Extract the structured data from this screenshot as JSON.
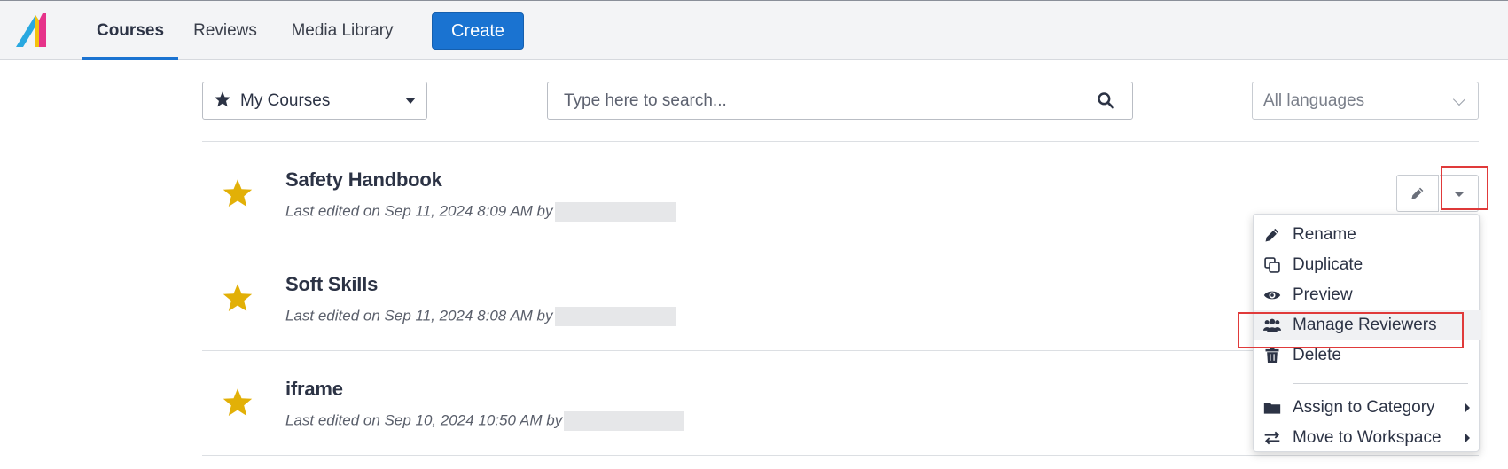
{
  "nav": {
    "tabs": [
      {
        "label": "Courses",
        "active": true
      },
      {
        "label": "Reviews",
        "active": false
      },
      {
        "label": "Media Library",
        "active": false
      }
    ],
    "create_label": "Create"
  },
  "filters": {
    "scope_selected": "My Courses",
    "scope_icon": "star-icon",
    "search_placeholder": "Type here to search...",
    "search_value": "",
    "language_selected": "All languages"
  },
  "courses": [
    {
      "title": "Safety Handbook",
      "meta": "Last edited on Sep 11, 2024 8:09 AM by",
      "favorite": true
    },
    {
      "title": "Soft Skills",
      "meta": "Last edited on Sep 11, 2024 8:08 AM by",
      "favorite": true
    },
    {
      "title": "iframe",
      "meta": "Last edited on Sep 10, 2024 10:50 AM by",
      "favorite": true
    }
  ],
  "menu": {
    "items": [
      {
        "label": "Rename",
        "icon": "pencil-icon"
      },
      {
        "label": "Duplicate",
        "icon": "duplicate-icon"
      },
      {
        "label": "Preview",
        "icon": "eye-icon"
      },
      {
        "label": "Manage Reviewers",
        "icon": "users-icon"
      },
      {
        "label": "Delete",
        "icon": "trash-icon"
      },
      {
        "label": "Assign to Category",
        "icon": "folder-icon",
        "submenu": true
      },
      {
        "label": "Move to Workspace",
        "icon": "swap-icon",
        "submenu": true
      }
    ]
  },
  "colors": {
    "accent": "#1a73d1",
    "star": "#e2b007",
    "highlight": "#e03a3a"
  }
}
